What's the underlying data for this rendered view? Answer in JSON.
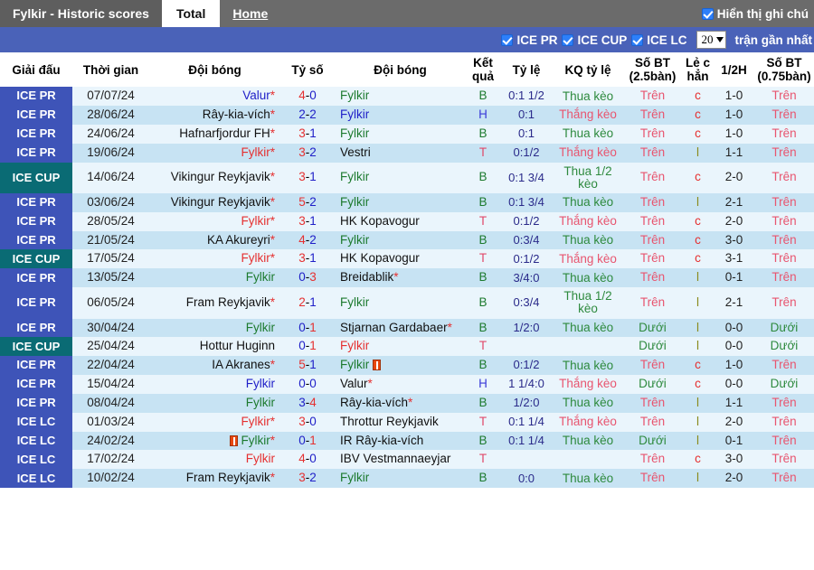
{
  "topbar": {
    "brand": "Fylkir - Historic scores",
    "tab_total": "Total",
    "tab_home": "Home",
    "show_notes_label": "Hiển thị ghi chú",
    "show_notes_checked": true
  },
  "filterbar": {
    "filters": [
      {
        "label": "ICE PR",
        "checked": true
      },
      {
        "label": "ICE CUP",
        "checked": true
      },
      {
        "label": "ICE LC",
        "checked": true
      }
    ],
    "count_value": "20",
    "recent_label": "trận gần nhất"
  },
  "columns": [
    "Giải đấu",
    "Thời gian",
    "Đội bóng",
    "Tỷ số",
    "Đội bóng",
    "Kết quả",
    "Tỷ lệ",
    "KQ tỷ lệ",
    "Số BT (2.5bàn)",
    "Lẻ c hẳn",
    "1/2H",
    "Số BT (0.75bàn)"
  ],
  "rows": [
    {
      "league": "ICE PR",
      "lg": "pr",
      "date": "07/07/24",
      "home": "Valur",
      "home_star": true,
      "home_color": "blue",
      "home_card": false,
      "score_hi": "4",
      "score_lo": "0",
      "score_order": "hi-lo",
      "away": "Fylkir",
      "away_star": false,
      "away_color": "green",
      "away_card": false,
      "result": "B",
      "odds": "0:1 1/2",
      "kq": "Thua kèo",
      "kq_type": "lose",
      "ou1": "Trên",
      "ou1_type": "over",
      "lc": "c",
      "half": "1-0",
      "ou2": "Trên",
      "ou2_type": "over"
    },
    {
      "league": "ICE PR",
      "lg": "pr",
      "date": "28/06/24",
      "home": "Rây-kia-vích",
      "home_star": true,
      "home_color": "black",
      "home_card": false,
      "score_hi": "2",
      "score_lo": "2",
      "score_order": "even",
      "away": "Fylkir",
      "away_star": false,
      "away_color": "blue",
      "away_card": false,
      "result": "H",
      "odds": "0:1",
      "kq": "Thắng kèo",
      "kq_type": "win",
      "ou1": "Trên",
      "ou1_type": "over",
      "lc": "c",
      "half": "1-0",
      "ou2": "Trên",
      "ou2_type": "over"
    },
    {
      "league": "ICE PR",
      "lg": "pr",
      "date": "24/06/24",
      "home": "Hafnarfjordur FH",
      "home_star": true,
      "home_color": "black",
      "home_card": false,
      "score_hi": "3",
      "score_lo": "1",
      "score_order": "hi-lo",
      "away": "Fylkir",
      "away_star": false,
      "away_color": "green",
      "away_card": false,
      "result": "B",
      "odds": "0:1",
      "kq": "Thua kèo",
      "kq_type": "lose",
      "ou1": "Trên",
      "ou1_type": "over",
      "lc": "c",
      "half": "1-0",
      "ou2": "Trên",
      "ou2_type": "over"
    },
    {
      "league": "ICE PR",
      "lg": "pr",
      "date": "19/06/24",
      "home": "Fylkir",
      "home_star": true,
      "home_color": "red",
      "home_card": false,
      "score_hi": "3",
      "score_lo": "2",
      "score_order": "hi-lo",
      "away": "Vestri",
      "away_star": false,
      "away_color": "black",
      "away_card": false,
      "result": "T",
      "odds": "0:1/2",
      "kq": "Thắng kèo",
      "kq_type": "win",
      "ou1": "Trên",
      "ou1_type": "over",
      "lc": "l",
      "half": "1-1",
      "ou2": "Trên",
      "ou2_type": "over"
    },
    {
      "league": "ICE CUP",
      "lg": "cup",
      "date": "14/06/24",
      "home": "Vikingur Reykjavik",
      "home_star": true,
      "home_color": "black",
      "home_card": false,
      "score_hi": "3",
      "score_lo": "1",
      "score_order": "hi-lo",
      "away": "Fylkir",
      "away_star": false,
      "away_color": "green",
      "away_card": false,
      "result": "B",
      "odds": "0:1 3/4",
      "kq": "Thua 1/2 kèo",
      "kq_type": "lose",
      "ou1": "Trên",
      "ou1_type": "over",
      "lc": "c",
      "half": "2-0",
      "ou2": "Trên",
      "ou2_type": "over"
    },
    {
      "league": "ICE PR",
      "lg": "pr",
      "date": "03/06/24",
      "home": "Vikingur Reykjavik",
      "home_star": true,
      "home_color": "black",
      "home_card": false,
      "score_hi": "5",
      "score_lo": "2",
      "score_order": "hi-lo",
      "away": "Fylkir",
      "away_star": false,
      "away_color": "green",
      "away_card": false,
      "result": "B",
      "odds": "0:1 3/4",
      "kq": "Thua kèo",
      "kq_type": "lose",
      "ou1": "Trên",
      "ou1_type": "over",
      "lc": "l",
      "half": "2-1",
      "ou2": "Trên",
      "ou2_type": "over"
    },
    {
      "league": "ICE PR",
      "lg": "pr",
      "date": "28/05/24",
      "home": "Fylkir",
      "home_star": true,
      "home_color": "red",
      "home_card": false,
      "score_hi": "3",
      "score_lo": "1",
      "score_order": "hi-lo",
      "away": "HK Kopavogur",
      "away_star": false,
      "away_color": "black",
      "away_card": false,
      "result": "T",
      "odds": "0:1/2",
      "kq": "Thắng kèo",
      "kq_type": "win",
      "ou1": "Trên",
      "ou1_type": "over",
      "lc": "c",
      "half": "2-0",
      "ou2": "Trên",
      "ou2_type": "over"
    },
    {
      "league": "ICE PR",
      "lg": "pr",
      "date": "21/05/24",
      "home": "KA Akureyri",
      "home_star": true,
      "home_color": "black",
      "home_card": false,
      "score_hi": "4",
      "score_lo": "2",
      "score_order": "hi-lo",
      "away": "Fylkir",
      "away_star": false,
      "away_color": "green",
      "away_card": false,
      "result": "B",
      "odds": "0:3/4",
      "kq": "Thua kèo",
      "kq_type": "lose",
      "ou1": "Trên",
      "ou1_type": "over",
      "lc": "c",
      "half": "3-0",
      "ou2": "Trên",
      "ou2_type": "over"
    },
    {
      "league": "ICE CUP",
      "lg": "cup",
      "date": "17/05/24",
      "home": "Fylkir",
      "home_star": true,
      "home_color": "red",
      "home_card": false,
      "score_hi": "3",
      "score_lo": "1",
      "score_order": "hi-lo",
      "away": "HK Kopavogur",
      "away_star": false,
      "away_color": "black",
      "away_card": false,
      "result": "T",
      "odds": "0:1/2",
      "kq": "Thắng kèo",
      "kq_type": "win",
      "ou1": "Trên",
      "ou1_type": "over",
      "lc": "c",
      "half": "3-1",
      "ou2": "Trên",
      "ou2_type": "over"
    },
    {
      "league": "ICE PR",
      "lg": "pr",
      "date": "13/05/24",
      "home": "Fylkir",
      "home_star": false,
      "home_color": "green",
      "home_card": false,
      "score_hi": "0",
      "score_lo": "3",
      "score_order": "lo-hi",
      "away": "Breidablik",
      "away_star": true,
      "away_color": "black",
      "away_card": false,
      "result": "B",
      "odds": "3/4:0",
      "kq": "Thua kèo",
      "kq_type": "lose",
      "ou1": "Trên",
      "ou1_type": "over",
      "lc": "l",
      "half": "0-1",
      "ou2": "Trên",
      "ou2_type": "over"
    },
    {
      "league": "ICE PR",
      "lg": "pr",
      "date": "06/05/24",
      "home": "Fram Reykjavik",
      "home_star": true,
      "home_color": "black",
      "home_card": false,
      "score_hi": "2",
      "score_lo": "1",
      "score_order": "hi-lo",
      "away": "Fylkir",
      "away_star": false,
      "away_color": "green",
      "away_card": false,
      "result": "B",
      "odds": "0:3/4",
      "kq": "Thua 1/2 kèo",
      "kq_type": "lose",
      "ou1": "Trên",
      "ou1_type": "over",
      "lc": "l",
      "half": "2-1",
      "ou2": "Trên",
      "ou2_type": "over"
    },
    {
      "league": "ICE PR",
      "lg": "pr",
      "date": "30/04/24",
      "home": "Fylkir",
      "home_star": false,
      "home_color": "green",
      "home_card": false,
      "score_hi": "0",
      "score_lo": "1",
      "score_order": "lo-hi",
      "away": "Stjarnan Gardabaer",
      "away_star": true,
      "away_color": "black",
      "away_card": false,
      "result": "B",
      "odds": "1/2:0",
      "kq": "Thua kèo",
      "kq_type": "lose",
      "ou1": "Dưới",
      "ou1_type": "under",
      "lc": "l",
      "half": "0-0",
      "ou2": "Dưới",
      "ou2_type": "under"
    },
    {
      "league": "ICE CUP",
      "lg": "cup",
      "date": "25/04/24",
      "home": "Hottur Huginn",
      "home_star": false,
      "home_color": "black",
      "home_card": false,
      "score_hi": "0",
      "score_lo": "1",
      "score_order": "lo-hi",
      "away": "Fylkir",
      "away_star": false,
      "away_color": "red",
      "away_card": false,
      "result": "T",
      "odds": "",
      "kq": "",
      "kq_type": "none",
      "ou1": "Dưới",
      "ou1_type": "under",
      "lc": "l",
      "half": "0-0",
      "ou2": "Dưới",
      "ou2_type": "under"
    },
    {
      "league": "ICE PR",
      "lg": "pr",
      "date": "22/04/24",
      "home": "IA Akranes",
      "home_star": true,
      "home_color": "black",
      "home_card": false,
      "score_hi": "5",
      "score_lo": "1",
      "score_order": "hi-lo",
      "away": "Fylkir",
      "away_star": false,
      "away_color": "green",
      "away_card": true,
      "result": "B",
      "odds": "0:1/2",
      "kq": "Thua kèo",
      "kq_type": "lose",
      "ou1": "Trên",
      "ou1_type": "over",
      "lc": "c",
      "half": "1-0",
      "ou2": "Trên",
      "ou2_type": "over"
    },
    {
      "league": "ICE PR",
      "lg": "pr",
      "date": "15/04/24",
      "home": "Fylkir",
      "home_star": false,
      "home_color": "blue",
      "home_card": false,
      "score_hi": "0",
      "score_lo": "0",
      "score_order": "even",
      "away": "Valur",
      "away_star": true,
      "away_color": "black",
      "away_card": false,
      "result": "H",
      "odds": "1 1/4:0",
      "kq": "Thắng kèo",
      "kq_type": "win",
      "ou1": "Dưới",
      "ou1_type": "under",
      "lc": "c",
      "half": "0-0",
      "ou2": "Dưới",
      "ou2_type": "under"
    },
    {
      "league": "ICE PR",
      "lg": "pr",
      "date": "08/04/24",
      "home": "Fylkir",
      "home_star": false,
      "home_color": "green",
      "home_card": false,
      "score_hi": "3",
      "score_lo": "4",
      "score_order": "lo-hi",
      "away": "Rây-kia-vích",
      "away_star": true,
      "away_color": "black",
      "away_card": false,
      "result": "B",
      "odds": "1/2:0",
      "kq": "Thua kèo",
      "kq_type": "lose",
      "ou1": "Trên",
      "ou1_type": "over",
      "lc": "l",
      "half": "1-1",
      "ou2": "Trên",
      "ou2_type": "over"
    },
    {
      "league": "ICE LC",
      "lg": "lc",
      "date": "01/03/24",
      "home": "Fylkir",
      "home_star": true,
      "home_color": "red",
      "home_card": false,
      "score_hi": "3",
      "score_lo": "0",
      "score_order": "hi-lo",
      "away": "Throttur Reykjavik",
      "away_star": false,
      "away_color": "black",
      "away_card": false,
      "result": "T",
      "odds": "0:1 1/4",
      "kq": "Thắng kèo",
      "kq_type": "win",
      "ou1": "Trên",
      "ou1_type": "over",
      "lc": "l",
      "half": "2-0",
      "ou2": "Trên",
      "ou2_type": "over"
    },
    {
      "league": "ICE LC",
      "lg": "lc",
      "date": "24/02/24",
      "home": "Fylkir",
      "home_star": true,
      "home_color": "green",
      "home_card": true,
      "score_hi": "0",
      "score_lo": "1",
      "score_order": "lo-hi",
      "away": "IR Rây-kia-vích",
      "away_star": false,
      "away_color": "black",
      "away_card": false,
      "result": "B",
      "odds": "0:1 1/4",
      "kq": "Thua kèo",
      "kq_type": "lose",
      "ou1": "Dưới",
      "ou1_type": "under",
      "lc": "l",
      "half": "0-1",
      "ou2": "Trên",
      "ou2_type": "over"
    },
    {
      "league": "ICE LC",
      "lg": "lc",
      "date": "17/02/24",
      "home": "Fylkir",
      "home_star": false,
      "home_color": "red",
      "home_card": false,
      "score_hi": "4",
      "score_lo": "0",
      "score_order": "hi-lo",
      "away": "IBV Vestmannaeyjar",
      "away_star": false,
      "away_color": "black",
      "away_card": false,
      "result": "T",
      "odds": "",
      "kq": "",
      "kq_type": "none",
      "ou1": "Trên",
      "ou1_type": "over",
      "lc": "c",
      "half": "3-0",
      "ou2": "Trên",
      "ou2_type": "over"
    },
    {
      "league": "ICE LC",
      "lg": "lc",
      "date": "10/02/24",
      "home": "Fram Reykjavik",
      "home_star": true,
      "home_color": "black",
      "home_card": false,
      "score_hi": "3",
      "score_lo": "2",
      "score_order": "hi-lo",
      "away": "Fylkir",
      "away_star": false,
      "away_color": "green",
      "away_card": false,
      "result": "B",
      "odds": "0:0",
      "kq": "Thua kèo",
      "kq_type": "lose",
      "ou1": "Trên",
      "ou1_type": "over",
      "lc": "l",
      "half": "2-0",
      "ou2": "Trên",
      "ou2_type": "over"
    }
  ]
}
